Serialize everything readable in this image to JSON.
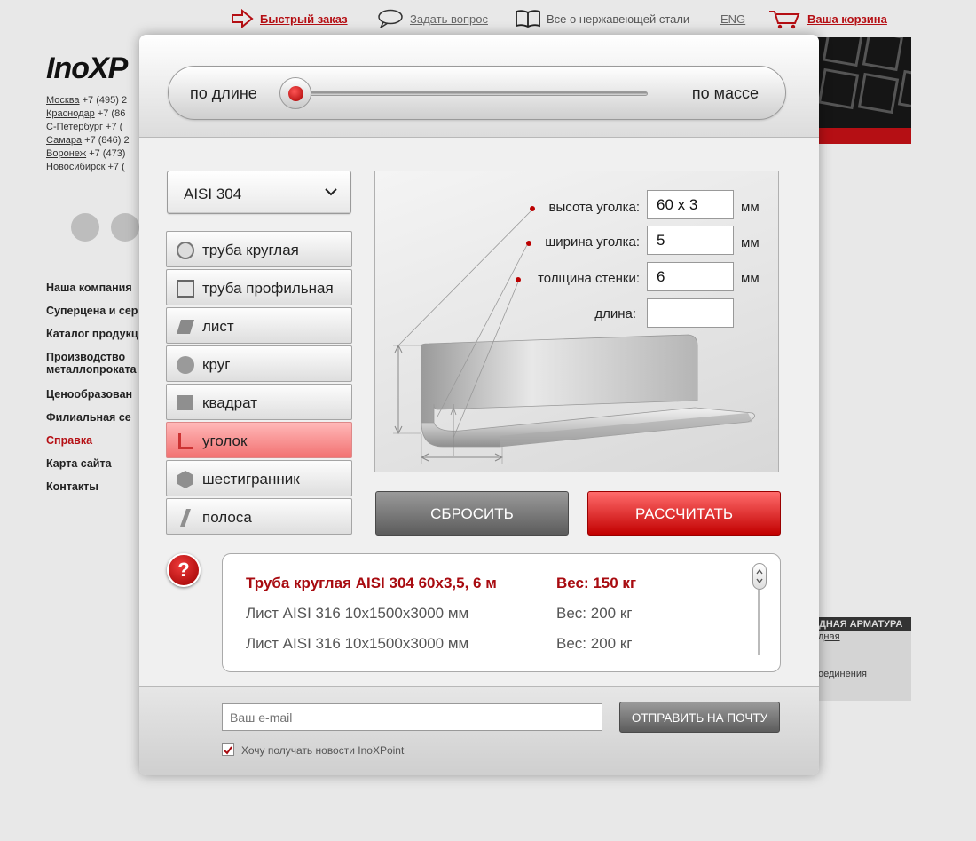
{
  "topnav": {
    "quick_order": "Быстрый заказ",
    "ask_question": "Задать вопрос",
    "about_steel": "Все о нержавеющей стали",
    "lang": "ENG",
    "cart": "Ваша корзина"
  },
  "logo": "InoXP",
  "cities": [
    {
      "name": "Москва",
      "phone": "+7 (495) 2"
    },
    {
      "name": "Краснодар",
      "phone": "+7 (86"
    },
    {
      "name": "С-Петербург",
      "phone": "+7 ("
    },
    {
      "name": "Самара",
      "phone": "+7 (846) 2"
    },
    {
      "name": "Воронеж",
      "phone": "+7 (473)"
    },
    {
      "name": "Новосибирск",
      "phone": "+7 ("
    }
  ],
  "leftmenu": [
    "Наша компания",
    "Суперцена и сер",
    "Каталог продукц",
    "Производство металлопроката",
    "Ценообразован",
    "Филиальная се",
    "Справка",
    "Карта сайта",
    "Контакты"
  ],
  "rightbox": {
    "header": "ДНАЯ АРМАТУРА",
    "link1": "дная",
    "link2": "оединения"
  },
  "modal": {
    "toggle": {
      "left": "по длине",
      "right": "по массе",
      "selected": "по длине"
    },
    "steel_grade": "AISI 304",
    "shapes": [
      {
        "label": "труба круглая",
        "icon": "round-pipe-icon"
      },
      {
        "label": "труба профильная",
        "icon": "profile-pipe-icon"
      },
      {
        "label": "лист",
        "icon": "sheet-icon"
      },
      {
        "label": "круг",
        "icon": "circle-bar-icon"
      },
      {
        "label": "квадрат",
        "icon": "square-bar-icon"
      },
      {
        "label": "уголок",
        "icon": "angle-icon"
      },
      {
        "label": "шестигранник",
        "icon": "hexagon-icon"
      },
      {
        "label": "полоса",
        "icon": "strip-icon"
      }
    ],
    "active_shape": "уголок",
    "params": {
      "height_label": "высота уголка:",
      "height_value": "60 x 3",
      "width_label": "ширина уголка:",
      "width_value": "5",
      "wall_label": "толщина стенки:",
      "wall_value": "6",
      "length_label": "длина:",
      "length_value": "",
      "unit": "мм"
    },
    "reset_button": "СБРОСИТЬ",
    "calc_button": "РАССЧИТАТЬ",
    "help_glyph": "?",
    "results": [
      {
        "name": "Труба круглая AISI 304 60x3,5, 6 м",
        "weight": "Вес: 150 кг",
        "highlight": true
      },
      {
        "name": "Лист AISI 316 10x1500x3000 мм",
        "weight": "Вес: 200 кг",
        "highlight": false
      },
      {
        "name": "Лист AISI 316 10x1500x3000 мм",
        "weight": "Вес: 200 кг",
        "highlight": false
      }
    ],
    "email_placeholder": "Ваш e-mail",
    "send_button": "ОТПРАВИТЬ НА ПОЧТУ",
    "subscribe_label": "Хочу получать новости InoXPoint",
    "subscribe_checked": true
  },
  "colors": {
    "accent_red": "#b50f14",
    "active_shape_bg": "#f27272"
  }
}
